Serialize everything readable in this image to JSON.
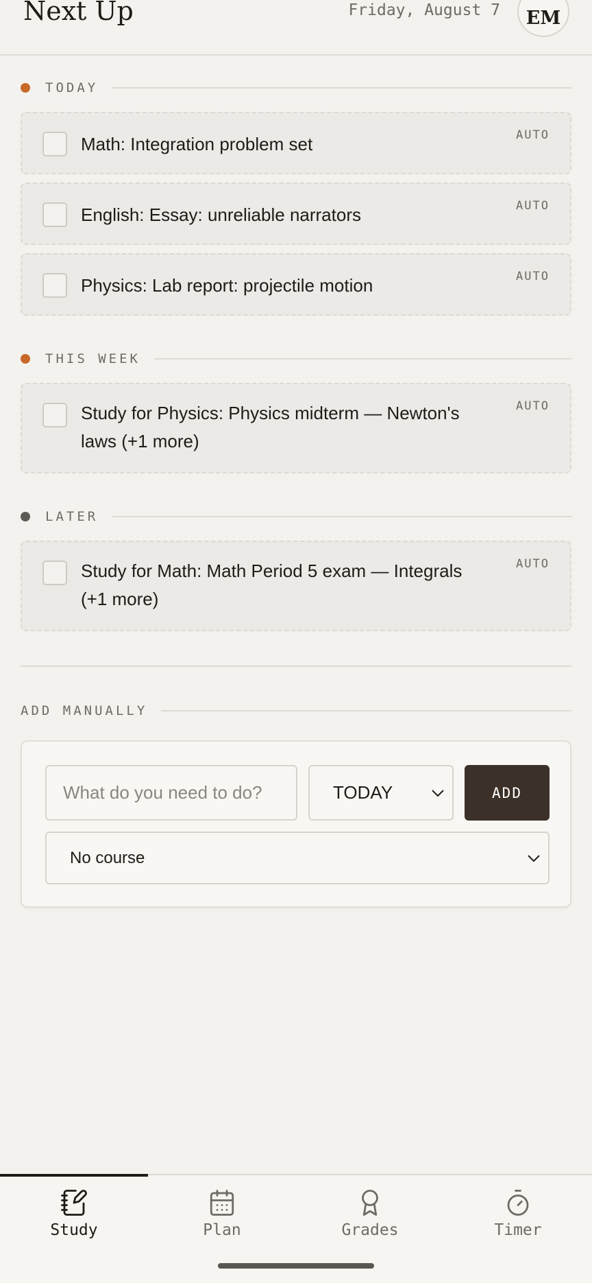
{
  "header": {
    "title": "Next Up",
    "date": "Friday, August 7",
    "avatar_initials": "EM"
  },
  "sections": [
    {
      "label": "TODAY",
      "dot_color": "#c8692a",
      "tasks": [
        {
          "text": "Math: Integration problem set",
          "tag": "AUTO",
          "checked": false
        },
        {
          "text": "English: Essay: unreliable narrators",
          "tag": "AUTO",
          "checked": false
        },
        {
          "text": "Physics: Lab report: projectile motion",
          "tag": "AUTO",
          "checked": false
        }
      ]
    },
    {
      "label": "THIS WEEK",
      "dot_color": "#c8692a",
      "tasks": [
        {
          "text": "Study for Physics: Physics midterm — Newton's laws (+1 more)",
          "tag": "AUTO",
          "checked": false
        }
      ]
    },
    {
      "label": "LATER",
      "dot_color": "#5e5a55",
      "tasks": [
        {
          "text": "Study for Math: Math Period 5 exam — Integrals (+1 more)",
          "tag": "AUTO",
          "checked": false
        }
      ]
    }
  ],
  "add_manually": {
    "label": "ADD MANUALLY",
    "task_placeholder": "What do you need to do?",
    "when_value": "TODAY",
    "add_label": "ADD",
    "course_value": "No course"
  },
  "tabs": [
    {
      "label": "Study",
      "icon": "notebook-pen-icon",
      "active": true
    },
    {
      "label": "Plan",
      "icon": "calendar-icon",
      "active": false
    },
    {
      "label": "Grades",
      "icon": "award-ribbon-icon",
      "active": false
    },
    {
      "label": "Timer",
      "icon": "stopwatch-icon",
      "active": false
    }
  ],
  "colors": {
    "background": "#f4f2ee",
    "accent": "#c8692a",
    "primary_button": "#3b3128"
  }
}
